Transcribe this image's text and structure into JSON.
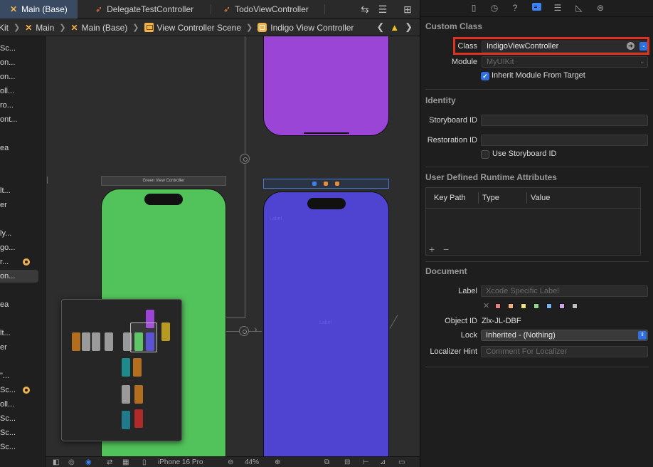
{
  "tabs": [
    {
      "label": "Main (Base)",
      "icon": "xcode-icon",
      "active": true
    },
    {
      "label": "DelegateTestController",
      "icon": "swift-icon",
      "active": false
    },
    {
      "label": "TodoViewController",
      "icon": "swift-icon",
      "active": false
    }
  ],
  "jumpbar": {
    "crumbs": [
      "Kit",
      "Main",
      "Main (Base)",
      "View Controller Scene",
      "Indigo View Controller"
    ]
  },
  "outline": {
    "items": [
      "Sc...",
      "on...",
      "on...",
      "oll...",
      "ro...",
      "ont...",
      "ea",
      "lt...",
      "er",
      "ly...",
      "go...",
      "r...",
      "on...",
      "ea",
      "lt...",
      "er",
      "\"...",
      "Sc...",
      "oll...",
      "Sc...",
      "Sc...",
      "Sc..."
    ]
  },
  "canvas": {
    "green_scene_title": "Green View Controller",
    "indigo_small_label": "Label",
    "device_label": "iPhone 16 Pro",
    "zoom_label": "44%"
  },
  "inspector": {
    "custom_class": {
      "title": "Custom Class",
      "class_label": "Class",
      "class_value": "IndigoViewController",
      "module_label": "Module",
      "module_value": "MyUIKit",
      "inherit_label": "Inherit Module From Target",
      "inherit_checked": true
    },
    "identity": {
      "title": "Identity",
      "storyboard_id_label": "Storyboard ID",
      "storyboard_id_value": "",
      "restoration_id_label": "Restoration ID",
      "restoration_id_value": "",
      "use_storyboard_id_label": "Use Storyboard ID",
      "use_storyboard_id_checked": false
    },
    "runtime_attributes": {
      "title": "User Defined Runtime Attributes",
      "columns": [
        "Key Path",
        "Type",
        "Value"
      ],
      "add_label": "+",
      "remove_label": "−"
    },
    "document": {
      "title": "Document",
      "label_label": "Label",
      "label_placeholder": "Xcode Specific Label",
      "label_colors": [
        "#e98080",
        "#f0b27a",
        "#f0e07a",
        "#8fd88f",
        "#7ab4f0",
        "#d4a0e6",
        "#bdbdbd"
      ],
      "object_id_label": "Object ID",
      "object_id_value": "Zlx-JL-DBF",
      "lock_label": "Lock",
      "lock_value": "Inherited - (Nothing)",
      "localizer_hint_label": "Localizer Hint",
      "localizer_hint_placeholder": "Comment For Localizer"
    }
  },
  "colors": {
    "purple_scene": "#9b45d6",
    "green_scene": "#52c25b",
    "indigo_scene": "#4f44d2",
    "accent": "#2f6fe0",
    "highlight": "#e0301e"
  }
}
